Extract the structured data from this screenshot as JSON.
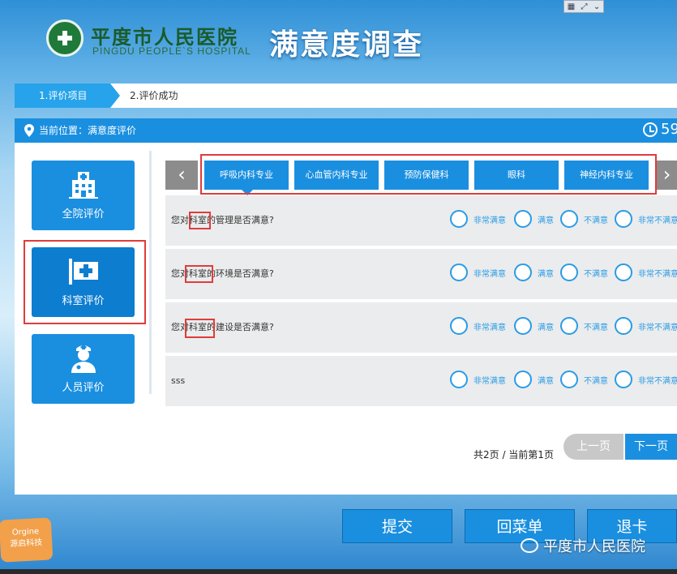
{
  "header": {
    "hospital_name": "平度市人民医院",
    "hospital_name_en": "PINGDU PEOPLE`S HOSPITAL",
    "survey_title": "满意度调查"
  },
  "steps": [
    {
      "label": "1.评价项目",
      "active": true
    },
    {
      "label": "2.评价成功",
      "active": false
    }
  ],
  "location": {
    "text": "当前位置：满意度评价",
    "timer": "59"
  },
  "sidebar": {
    "items": [
      {
        "label": "全院评价",
        "icon": "hospital-building-icon"
      },
      {
        "label": "科室评价",
        "icon": "department-cross-icon",
        "active": true
      },
      {
        "label": "人员评价",
        "icon": "doctor-icon"
      }
    ]
  },
  "tabs": {
    "items": [
      "呼吸内科专业",
      "心血管内科专业",
      "预防保健科",
      "眼科",
      "神经内科专业"
    ],
    "active_index": 0
  },
  "options": [
    "非常满意",
    "满意",
    "不满意",
    "非常不满意"
  ],
  "questions": [
    {
      "text": "您对科室的管理是否满意?"
    },
    {
      "text": "您对科室的环境是否满意?"
    },
    {
      "text": "您对科室的建设是否满意?"
    },
    {
      "text": "sss"
    }
  ],
  "pagination": {
    "info": "共2页 / 当前第1页",
    "prev_label": "上一页",
    "next_label": "下一页"
  },
  "actions": {
    "submit": "提交",
    "menu": "回菜单",
    "exit": "退卡"
  },
  "badge": {
    "line1": "Orgine",
    "line2": "源启科技"
  },
  "watermark": {
    "text": "平度市人民医院"
  },
  "colors": {
    "primary": "#1a8fe0",
    "highlight": "#e03c3c",
    "disabled": "#c8c8c8"
  }
}
